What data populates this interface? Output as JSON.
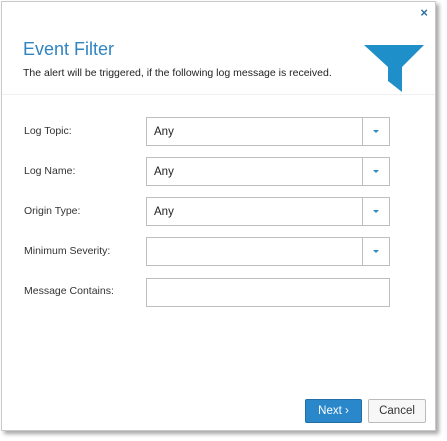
{
  "dialog": {
    "close_glyph": "×",
    "title": "Event Filter",
    "subtitle": "The alert will be triggered, if the following log message is received.",
    "header_icon": "funnel-icon",
    "accent_color": "#2f84c2"
  },
  "fields": {
    "log_topic": {
      "label": "Log Topic:",
      "value": "Any"
    },
    "log_name": {
      "label": "Log Name:",
      "value": "Any"
    },
    "origin_type": {
      "label": "Origin Type:",
      "value": "Any"
    },
    "minimum_severity": {
      "label": "Minimum Severity:",
      "value": ""
    },
    "message_contains": {
      "label": "Message Contains:",
      "value": ""
    }
  },
  "footer": {
    "next_label": "Next ›",
    "cancel_label": "Cancel",
    "primary_color": "#2a87c9"
  }
}
